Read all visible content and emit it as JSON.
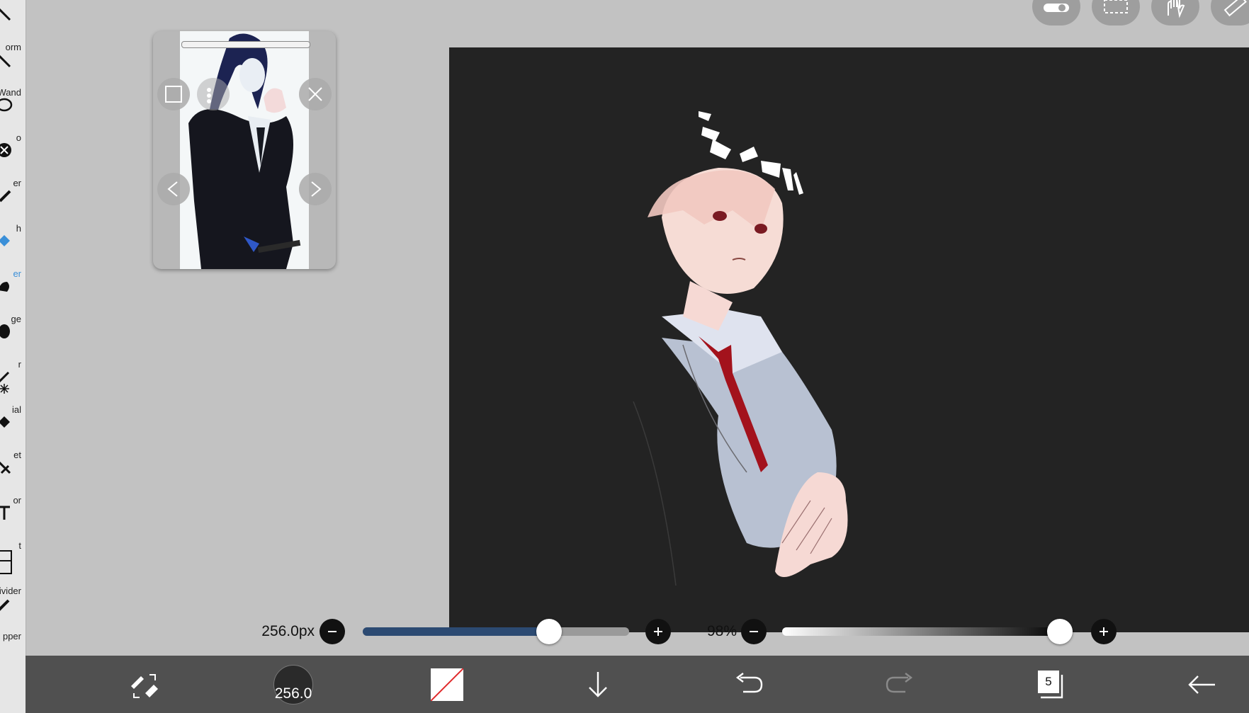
{
  "tools": [
    {
      "label": "orm",
      "icon": "transform-icon"
    },
    {
      "label": "Wand",
      "icon": "magic-wand-icon"
    },
    {
      "label": "o",
      "icon": "lasso-icon"
    },
    {
      "label": "er",
      "icon": "filter-icon"
    },
    {
      "label": "h",
      "icon": "brush-icon"
    },
    {
      "label": "er",
      "icon": "eraser-icon",
      "active": true
    },
    {
      "label": "ge",
      "icon": "smudge-icon"
    },
    {
      "label": "r",
      "icon": "blur-icon"
    },
    {
      "label": "ial",
      "icon": "special-pen-icon"
    },
    {
      "label": "et",
      "icon": "bucket-icon"
    },
    {
      "label": "or",
      "icon": "eyedropper-icon"
    },
    {
      "label": "t",
      "icon": "text-icon"
    },
    {
      "label": "ivider",
      "icon": "frame-divider-icon"
    },
    {
      "label": "pper",
      "icon": "eyedropper2-icon"
    }
  ],
  "brush": {
    "size_label": "256.0px",
    "size_fraction": 0.7,
    "circle_value": "256.0"
  },
  "opacity": {
    "label": "98%",
    "fraction": 0.98
  },
  "bottom_bar": {
    "layer_count": "5"
  },
  "icons": {
    "top": [
      "toggle-icon",
      "selection-icon",
      "hand-icon",
      "ruler-icon"
    ],
    "reference": [
      "frame-icon",
      "dots-icon",
      "close-icon",
      "prev-icon",
      "next-icon"
    ],
    "bottom": [
      "pen-eraser-swap-icon",
      "brush-size-icon",
      "color-icon",
      "download-icon",
      "undo-icon",
      "redo-icon",
      "layers-icon",
      "back-icon"
    ]
  },
  "colors": {
    "accent": "#3a8fd8",
    "slider_fill": "#2c4a72",
    "bottom_bar": "#505050",
    "canvas": "#232323",
    "workspace": "#c2c2c2"
  }
}
